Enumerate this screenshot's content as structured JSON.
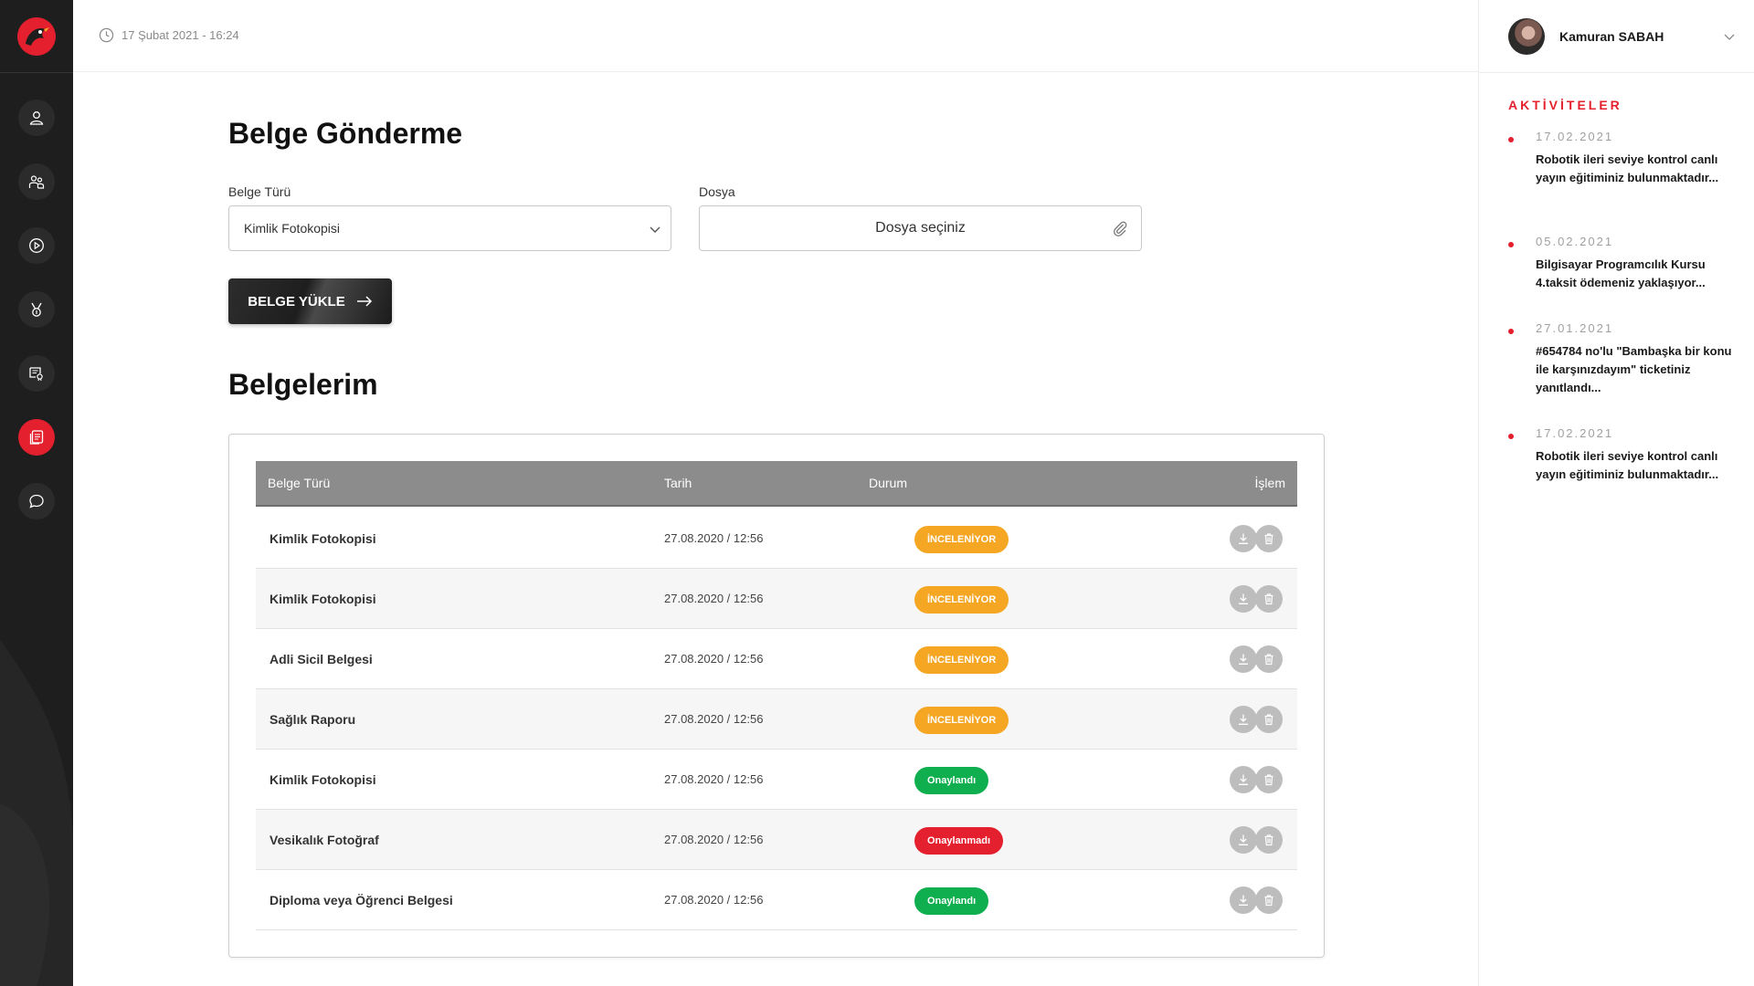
{
  "colors": {
    "accent": "#e5202e",
    "nav_bg": "#1e1e1e",
    "status_review": "#f5a623",
    "status_approved": "#0fae4e",
    "status_rejected": "#e5202e",
    "table_header": "#8c8c8c"
  },
  "nav": {
    "items": [
      {
        "icon": "user-icon"
      },
      {
        "icon": "group-icon"
      },
      {
        "icon": "play-icon"
      },
      {
        "icon": "medal-icon"
      },
      {
        "icon": "certificate-icon"
      },
      {
        "icon": "document-icon",
        "active": true
      },
      {
        "icon": "chat-icon"
      }
    ]
  },
  "topbar": {
    "datetime": "17 Şubat 2021 - 16:24"
  },
  "user": {
    "name": "Kamuran SABAH"
  },
  "activities": {
    "title": "AKTİVİTELER",
    "items": [
      {
        "date": "17.02.2021",
        "text": "Robotik ileri seviye kontrol canlı yayın eğitiminiz bulunmaktadır..."
      },
      {
        "date": "05.02.2021",
        "text": "Bilgisayar Programcılık Kursu 4.taksit ödemeniz yaklaşıyor..."
      },
      {
        "date": "27.01.2021",
        "text": "#654784 no'lu \"Bambaşka bir konu ile karşınızdayım\" ticketiniz yanıtlandı..."
      },
      {
        "date": "17.02.2021",
        "text": "Robotik ileri seviye kontrol canlı yayın eğitiminiz bulunmaktadır..."
      }
    ]
  },
  "upload": {
    "title": "Belge Gönderme",
    "type_label": "Belge Türü",
    "type_value": "Kimlik Fotokopisi",
    "file_label": "Dosya",
    "file_placeholder": "Dosya seçiniz",
    "button_label": "BELGE YÜKLE"
  },
  "documents": {
    "title": "Belgelerim",
    "columns": {
      "type": "Belge Türü",
      "date": "Tarih",
      "status": "Durum",
      "action": "İşlem"
    },
    "rows": [
      {
        "type": "Kimlik Fotokopisi",
        "date": "27.08.2020 / 12:56",
        "status": "İNCELENİYOR",
        "status_kind": "review"
      },
      {
        "type": "Kimlik Fotokopisi",
        "date": "27.08.2020 / 12:56",
        "status": "İNCELENİYOR",
        "status_kind": "review"
      },
      {
        "type": "Adli Sicil Belgesi",
        "date": "27.08.2020 / 12:56",
        "status": "İNCELENİYOR",
        "status_kind": "review"
      },
      {
        "type": "Sağlık Raporu",
        "date": "27.08.2020 / 12:56",
        "status": "İNCELENİYOR",
        "status_kind": "review"
      },
      {
        "type": "Kimlik Fotokopisi",
        "date": "27.08.2020 / 12:56",
        "status": "Onaylandı",
        "status_kind": "approved"
      },
      {
        "type": "Vesikalık Fotoğraf",
        "date": "27.08.2020 / 12:56",
        "status": "Onaylanmadı",
        "status_kind": "rejected"
      },
      {
        "type": "Diploma veya Öğrenci Belgesi",
        "date": "27.08.2020 / 12:56",
        "status": "Onaylandı",
        "status_kind": "approved"
      }
    ]
  }
}
